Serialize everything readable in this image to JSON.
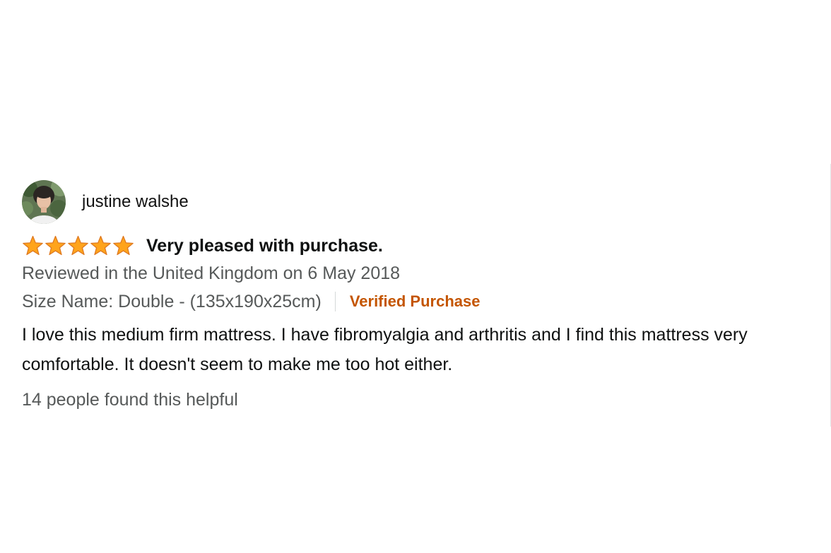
{
  "review": {
    "reviewer_name": "justine walshe",
    "rating": 5,
    "rating_max": 5,
    "title": "Very pleased with purchase.",
    "review_date_line": "Reviewed in the United Kingdom on 6 May 2018",
    "variant": "Size Name: Double - (135x190x25cm)",
    "verified_label": "Verified Purchase",
    "body": "I love this medium firm mattress. I have fibromyalgia and arthritis and I find this mattress very comfortable. It doesn't seem to make me too hot either.",
    "helpful_text": "14 people found this helpful"
  },
  "colors": {
    "star_fill": "#ffa41c",
    "star_stroke": "#de7921",
    "verified": "#c45500",
    "meta_text": "#565959",
    "primary_text": "#0f1111"
  },
  "icons": {
    "avatar": "avatar-image",
    "star": "star-icon"
  }
}
